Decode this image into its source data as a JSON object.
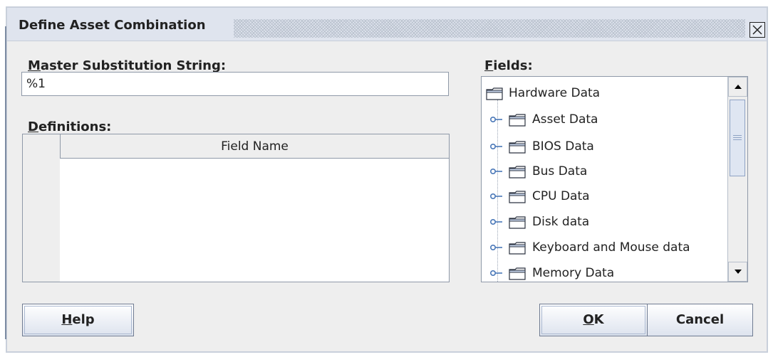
{
  "window": {
    "title": "Define Asset Combination",
    "close_icon": "close-icon"
  },
  "master": {
    "label_mnemonic": "M",
    "label_rest": "aster Substitution String:",
    "value": "%1"
  },
  "definitions": {
    "label_mnemonic": "D",
    "label_rest": "efinitions:",
    "columns": [
      "Field Name"
    ]
  },
  "fields": {
    "label_mnemonic": "F",
    "label_rest": "ields:",
    "root": "Hardware Data",
    "items": [
      "Asset Data",
      "BIOS Data",
      "Bus Data",
      "CPU Data",
      "Disk data",
      "Keyboard and Mouse data",
      "Memory Data"
    ]
  },
  "buttons": {
    "help_mnemonic": "H",
    "help_rest": "elp",
    "ok_mnemonic": "O",
    "ok_rest": "K",
    "cancel": "Cancel"
  },
  "colors": {
    "background": "#eeeeee",
    "titlebar": "#dfe4ee",
    "border": "#8f99a8",
    "accent": "#8fa3c4"
  }
}
